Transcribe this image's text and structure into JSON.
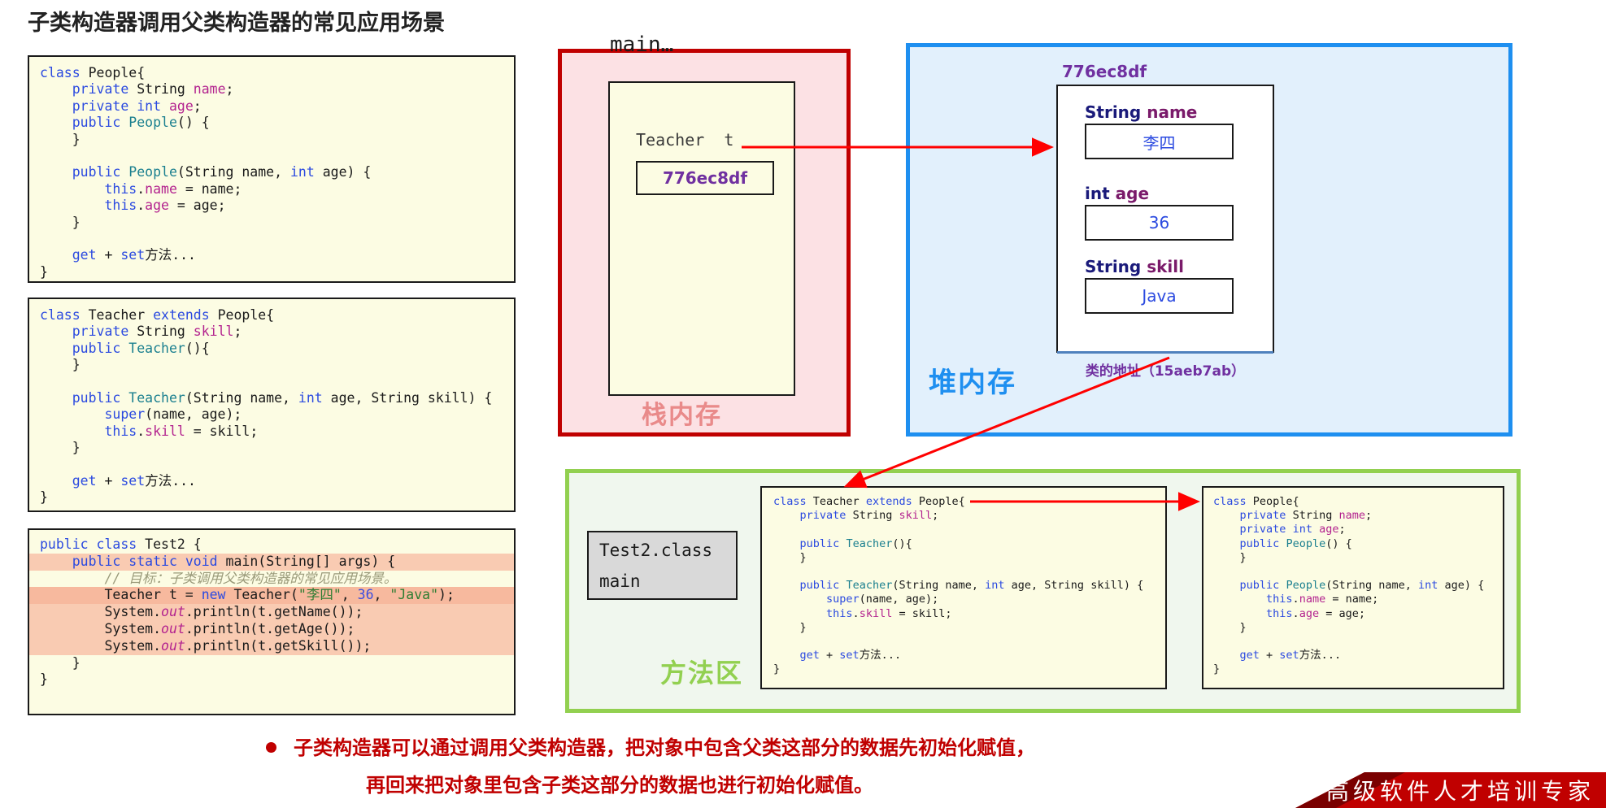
{
  "page_title": "子类构造器调用父类构造器的常见应用场景",
  "colors": {
    "stack_border": "#c00000",
    "stack_fill": "#fce1e4",
    "heap_border": "#1e8ff0",
    "heap_fill": "#e2f0fc",
    "method_border": "#92d050",
    "method_fill": "#f0f7ee",
    "code_fill": "#fcfce3",
    "highlight": "#f9cbb2",
    "accent_red": "#c00000",
    "address_purple": "#7030a0"
  },
  "code_blocks": {
    "people": {
      "title": "class People",
      "lines": [
        "class People{",
        "    private String name;",
        "    private int age;",
        "    public People() {",
        "    }",
        "",
        "    public People(String name, int age) {",
        "        this.name = name;",
        "        this.age = age;",
        "    }",
        "",
        "    get + set方法...",
        "}"
      ]
    },
    "teacher": {
      "title": "class Teacher extends People",
      "lines": [
        "class Teacher extends People{",
        "    private String skill;",
        "    public Teacher(){",
        "    }",
        "",
        "    public Teacher(String name, int age, String skill) {",
        "        super(name, age);",
        "        this.skill = skill;",
        "    }",
        "",
        "    get + set方法...",
        "}"
      ]
    },
    "test2": {
      "title": "public class Test2",
      "lines": [
        "public class Test2 {",
        "    public static void main(String[] args) {",
        "        // 目标：子类调用父类构造器的常见应用场景。",
        "        Teacher t = new Teacher(\"李四\", 36, \"Java\");",
        "        System.out.println(t.getName());",
        "        System.out.println(t.getAge());",
        "        System.out.println(t.getSkill());",
        "    }",
        "}"
      ],
      "comment_text": "// 目标：子类调用父类构造器的常见应用场景。",
      "new_call_args": {
        "name": "\"李四\"",
        "age": "36",
        "skill": "\"Java\""
      }
    },
    "method_area_teacher": {
      "lines": [
        "class Teacher extends People{",
        "    private String skill;",
        "",
        "    public Teacher(){",
        "    }",
        "",
        "    public Teacher(String name, int age, String skill) {",
        "        super(name, age);",
        "        this.skill = skill;",
        "    }",
        "",
        "    get + set方法...",
        "}"
      ]
    },
    "method_area_people": {
      "lines": [
        "class People{",
        "    private String name;",
        "    private int age;",
        "    public People() {",
        "    }",
        "",
        "    public People(String name, int age) {",
        "        this.name = name;",
        "        this.age = age;",
        "    }",
        "",
        "    get + set方法...",
        "}"
      ]
    }
  },
  "stack": {
    "region_title": "栈内存",
    "frame_label": "main…",
    "variable_name": "Teacher  t",
    "variable_value": "776ec8df"
  },
  "heap": {
    "region_title": "堆内存",
    "object_address": "776ec8df",
    "fields": [
      {
        "type": "String",
        "name": "name",
        "value": "李四"
      },
      {
        "type": "int",
        "name": "age",
        "value": "36"
      },
      {
        "type": "String",
        "name": "skill",
        "value": "Java"
      }
    ],
    "class_address_label": "类的地址（15aeb7ab）"
  },
  "method_area": {
    "region_title": "方法区",
    "class_file": {
      "line1": "Test2.class",
      "line2": "main"
    }
  },
  "footer": {
    "bullet_line1": "子类构造器可以通过调用父类构造器，把对象中包含父类这部分的数据先初始化赋值，",
    "bullet_line2": "再回来把对象里包含子类这部分的数据也进行初始化赋值。",
    "banner_text": "高级软件人才培训专家"
  }
}
